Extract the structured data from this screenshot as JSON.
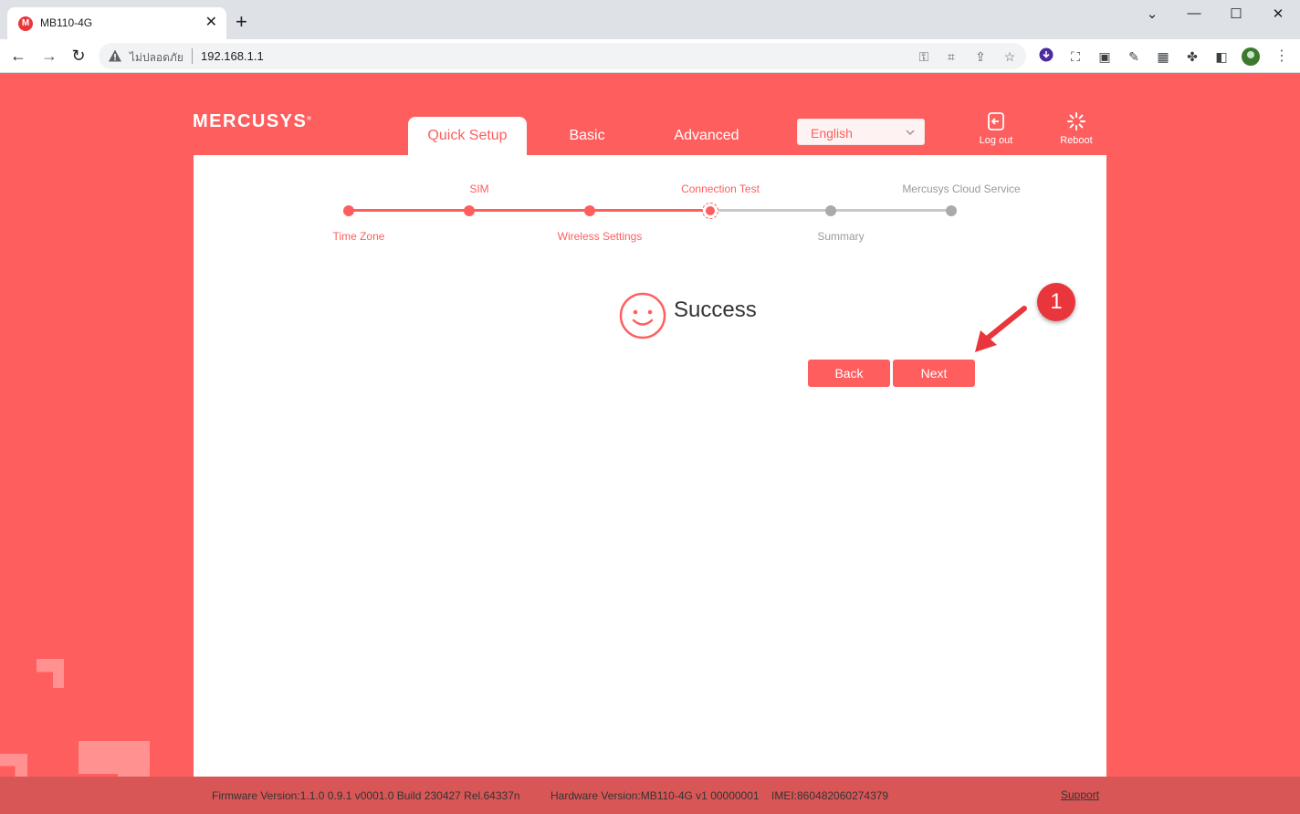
{
  "browser": {
    "tab_title": "MB110-4G",
    "tab_favicon_letter": "M",
    "tab_close": "✕",
    "new_tab": "+",
    "security_label": "ไม่ปลอดภัย",
    "url": "192.168.1.1",
    "window_controls": {
      "chevron": "⌄",
      "minimize": "—",
      "maximize": "☐",
      "close": "✕"
    }
  },
  "router": {
    "logo": "MERCUSYS",
    "logo_reg": "®",
    "nav": {
      "quick_setup": "Quick Setup",
      "basic": "Basic",
      "advanced": "Advanced"
    },
    "language": {
      "selected": "English"
    },
    "actions": {
      "logout": "Log out",
      "reboot": "Reboot"
    },
    "wizard": {
      "steps": [
        {
          "label": "Time Zone",
          "state": "done"
        },
        {
          "label": "SIM",
          "state": "done"
        },
        {
          "label": "Wireless Settings",
          "state": "done"
        },
        {
          "label": "Connection Test",
          "state": "current"
        },
        {
          "label": "Summary",
          "state": "todo"
        },
        {
          "label": "Mercusys Cloud Service",
          "state": "todo"
        }
      ],
      "result": "Success"
    },
    "buttons": {
      "back": "Back",
      "next": "Next"
    },
    "footer": {
      "firmware": "Firmware Version:1.1.0 0.9.1 v0001.0 Build 230427 Rel.64337n",
      "hardware": "Hardware Version:MB110-4G v1 00000001",
      "imei": "IMEI:860482060274379",
      "support": "Support"
    }
  },
  "annotation": {
    "badge": "1"
  },
  "colors": {
    "brand": "#ff5e5e",
    "badge": "#e8363c"
  }
}
